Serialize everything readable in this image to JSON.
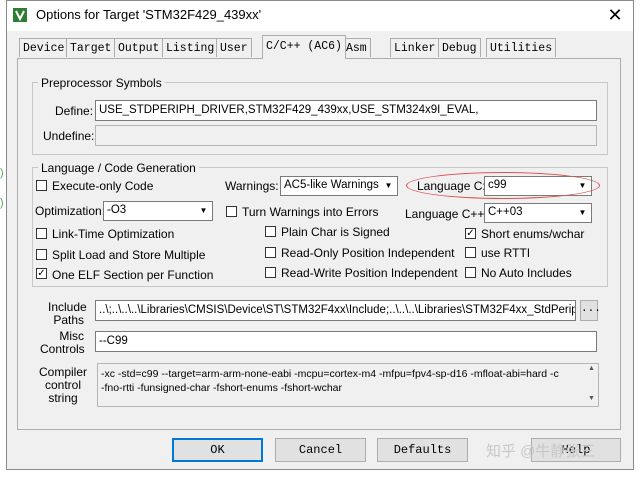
{
  "window": {
    "title": "Options for Target 'STM32F429_439xx'",
    "close_glyph": "✕"
  },
  "tabs": [
    {
      "label": "Device"
    },
    {
      "label": "Target"
    },
    {
      "label": "Output"
    },
    {
      "label": "Listing"
    },
    {
      "label": "User"
    },
    {
      "label": "C/C++ (AC6)"
    },
    {
      "label": "Asm"
    },
    {
      "label": "Linker"
    },
    {
      "label": "Debug"
    },
    {
      "label": "Utilities"
    }
  ],
  "active_tab": "C/C++ (AC6)",
  "preprocessor": {
    "group_label": "Preprocessor Symbols",
    "define_label": "Define:",
    "define_value": "USE_STDPERIPH_DRIVER,STM32F429_439xx,USE_STM324x9I_EVAL,",
    "undefine_label": "Undefine:",
    "undefine_value": ""
  },
  "language": {
    "group_label": "Language / Code Generation",
    "execute_only": {
      "label": "Execute-only Code",
      "checked": false
    },
    "warnings_label": "Warnings:",
    "warnings_value": "AC5-like Warnings",
    "language_c_label": "Language C:",
    "language_c_value": "c99",
    "optimization_label": "Optimization:",
    "optimization_value": "-O3",
    "turn_warnings_errors": {
      "label": "Turn Warnings into Errors",
      "checked": false
    },
    "language_cpp_label": "Language C++:",
    "language_cpp_value": "C++03",
    "link_time_opt": {
      "label": "Link-Time Optimization",
      "checked": false
    },
    "plain_char_signed": {
      "label": "Plain Char is Signed",
      "checked": false
    },
    "short_enums": {
      "label": "Short enums/wchar",
      "checked": true
    },
    "split_load_store": {
      "label": "Split Load and Store Multiple",
      "checked": false
    },
    "ro_pos_indep": {
      "label": "Read-Only Position Independent",
      "checked": false
    },
    "use_rtti": {
      "label": "use RTTI",
      "checked": false
    },
    "one_elf": {
      "label": "One ELF Section per Function",
      "checked": true
    },
    "rw_pos_indep": {
      "label": "Read-Write Position Independent",
      "checked": false
    },
    "no_auto_includes": {
      "label": "No Auto Includes",
      "checked": false
    }
  },
  "include_paths": {
    "label_line1": "Include",
    "label_line2": "Paths",
    "value": "..\\;..\\..\\..\\Libraries\\CMSIS\\Device\\ST\\STM32F4xx\\Include;..\\..\\..\\Libraries\\STM32F4xx_StdPeriph_",
    "browse_label": "..."
  },
  "misc_controls": {
    "label_line1": "Misc",
    "label_line2": "Controls",
    "value": "--C99"
  },
  "compiler_control": {
    "label_line1": "Compiler",
    "label_line2": "control",
    "label_line3": "string",
    "line1": "-xc -std=c99 --target=arm-arm-none-eabi -mcpu=cortex-m4 -mfpu=fpv4-sp-d16 -mfloat-abi=hard -c",
    "line2": "-fno-rtti -funsigned-char -fshort-enums -fshort-wchar"
  },
  "buttons": {
    "ok": "OK",
    "cancel": "Cancel",
    "defaults": "Defaults",
    "help": "Help"
  },
  "watermark": "知乎 @牛静张三",
  "colors": {
    "accent_border": "#0078d7",
    "highlight_oval": "#d9534f"
  }
}
